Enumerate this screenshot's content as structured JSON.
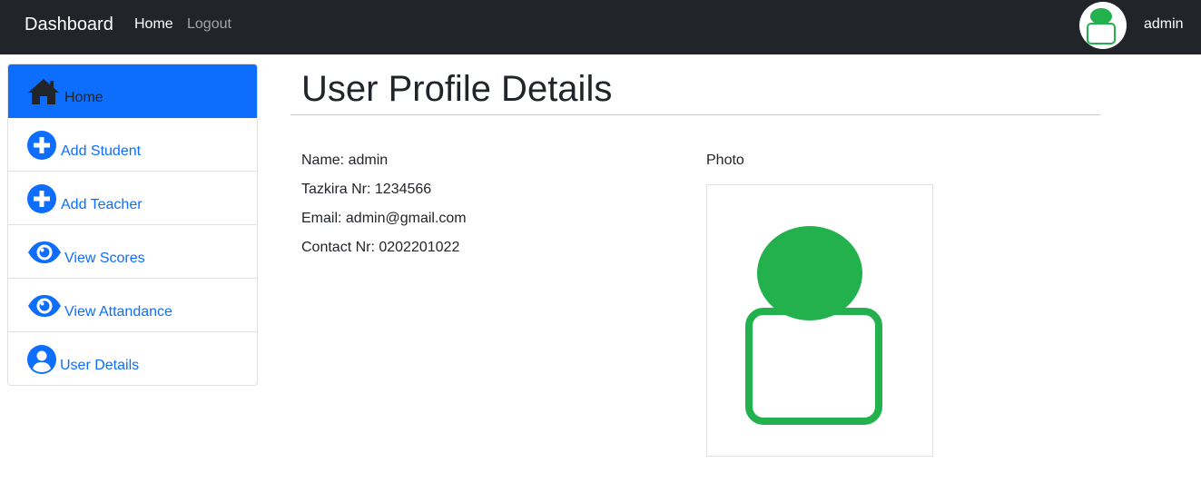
{
  "navbar": {
    "brand": "Dashboard",
    "links": {
      "home": "Home",
      "logout": "Logout"
    },
    "username": "admin",
    "avatar_icon": "user-avatar-icon"
  },
  "sidebar": {
    "items": [
      {
        "label": "Home",
        "icon": "home-icon",
        "active": true
      },
      {
        "label": "Add Student",
        "icon": "plus-circle-icon"
      },
      {
        "label": "Add Teacher",
        "icon": "plus-circle-icon"
      },
      {
        "label": "View Scores",
        "icon": "eye-icon"
      },
      {
        "label": "View Attandance",
        "icon": "eye-icon"
      },
      {
        "label": "User Details",
        "icon": "person-circle-icon"
      }
    ]
  },
  "main": {
    "title": "User Profile Details",
    "fields": {
      "name": "Name: admin",
      "tazkira": "Tazkira Nr: 1234566",
      "email": "Email: admin@gmail.com",
      "contact": "Contact Nr: 0202201022"
    },
    "photo_label": "Photo"
  },
  "colors": {
    "navbar_bg": "#212529",
    "primary": "#0d6efd",
    "avatar_green": "#22b14c"
  }
}
